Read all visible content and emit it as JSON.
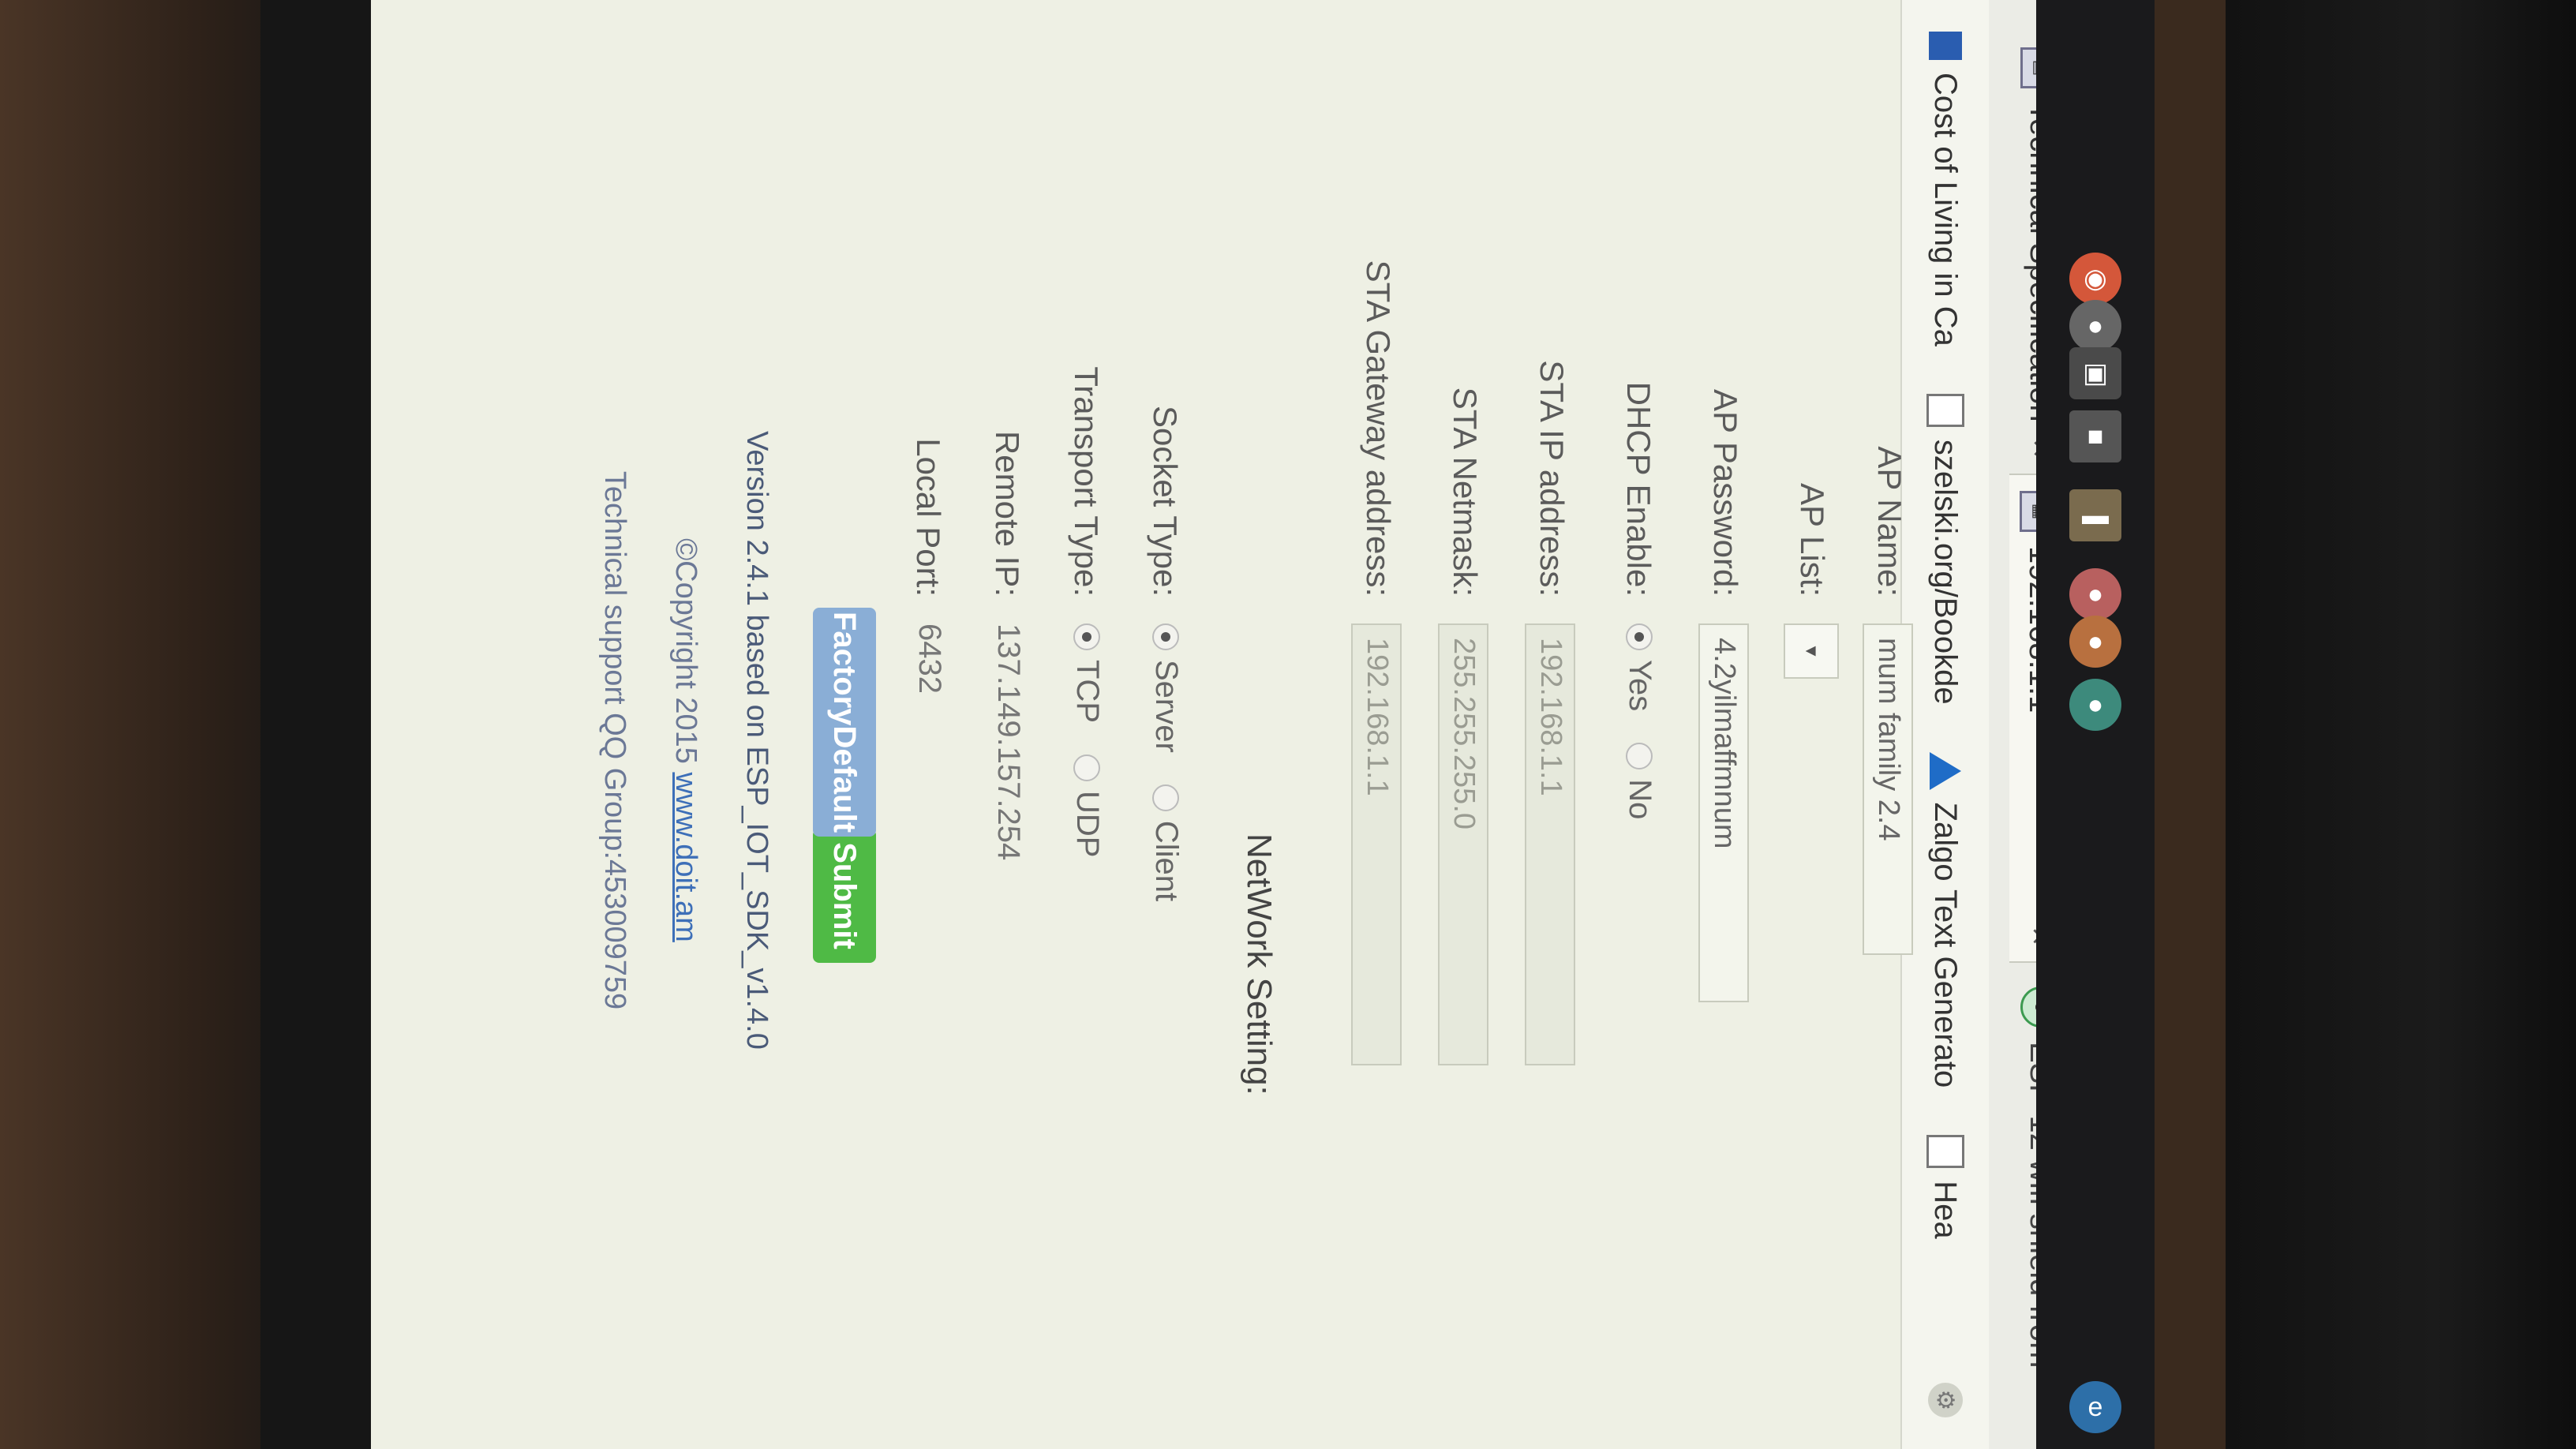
{
  "browser": {
    "tabs": [
      {
        "label": "Technical Specification",
        "icon": "document-icon"
      },
      {
        "label": "192.168.1.1",
        "icon": "router-icon"
      },
      {
        "label": "ESP-12 wifi shield from",
        "icon": "ie-icon"
      }
    ],
    "bookmarks": [
      {
        "label": "Cost of Living in Ca",
        "icon": "flag-icon"
      },
      {
        "label": "szelski.org/Bookde",
        "icon": "document-icon"
      },
      {
        "label": "Zalgo Text Generato",
        "icon": "triangle-icon"
      },
      {
        "label": "Hea",
        "icon": "document-icon"
      }
    ]
  },
  "form": {
    "ap_name": {
      "label": "AP Name:",
      "value": "mum family 2.4"
    },
    "ap_list": {
      "label": "AP List:"
    },
    "ap_password": {
      "label": "AP Password:",
      "value": "4.2yilmaffmnum"
    },
    "dhcp": {
      "label": "DHCP Enable:",
      "options": [
        "Yes",
        "No"
      ],
      "selected": "Yes"
    },
    "sta_ip": {
      "label": "STA IP address:",
      "value": "192.168.1.1"
    },
    "sta_netmask": {
      "label": "STA Netmask:",
      "value": "255.255.255.0"
    },
    "sta_gateway": {
      "label": "STA Gateway address:",
      "value": "192.168.1.1"
    }
  },
  "network": {
    "title": "NetWork Setting:",
    "socket_type": {
      "label": "Socket Type:",
      "options": [
        "Server",
        "Client"
      ],
      "selected": "Server"
    },
    "transport_type": {
      "label": "Transport Type:",
      "options": [
        "TCP",
        "UDP"
      ],
      "selected": "TCP"
    },
    "remote_ip": {
      "label": "Remote IP:",
      "value": "137.149.157.254"
    },
    "local_port": {
      "label": "Local Port:",
      "value": "6432"
    }
  },
  "buttons": {
    "submit": "Submit",
    "factory_default": "FactoryDefault"
  },
  "footer": {
    "version": "Version 2.4.1 based on ESP_IOT_SDK_v1.4.0",
    "copyright": "©Copyright 2015",
    "copyright_link": "www.doit.am",
    "support": "Technical support QQ Group:453009759"
  },
  "colors": {
    "submit": "#4fba45",
    "factory_default": "#8aaed6",
    "page_bg": "#eef0e4"
  }
}
